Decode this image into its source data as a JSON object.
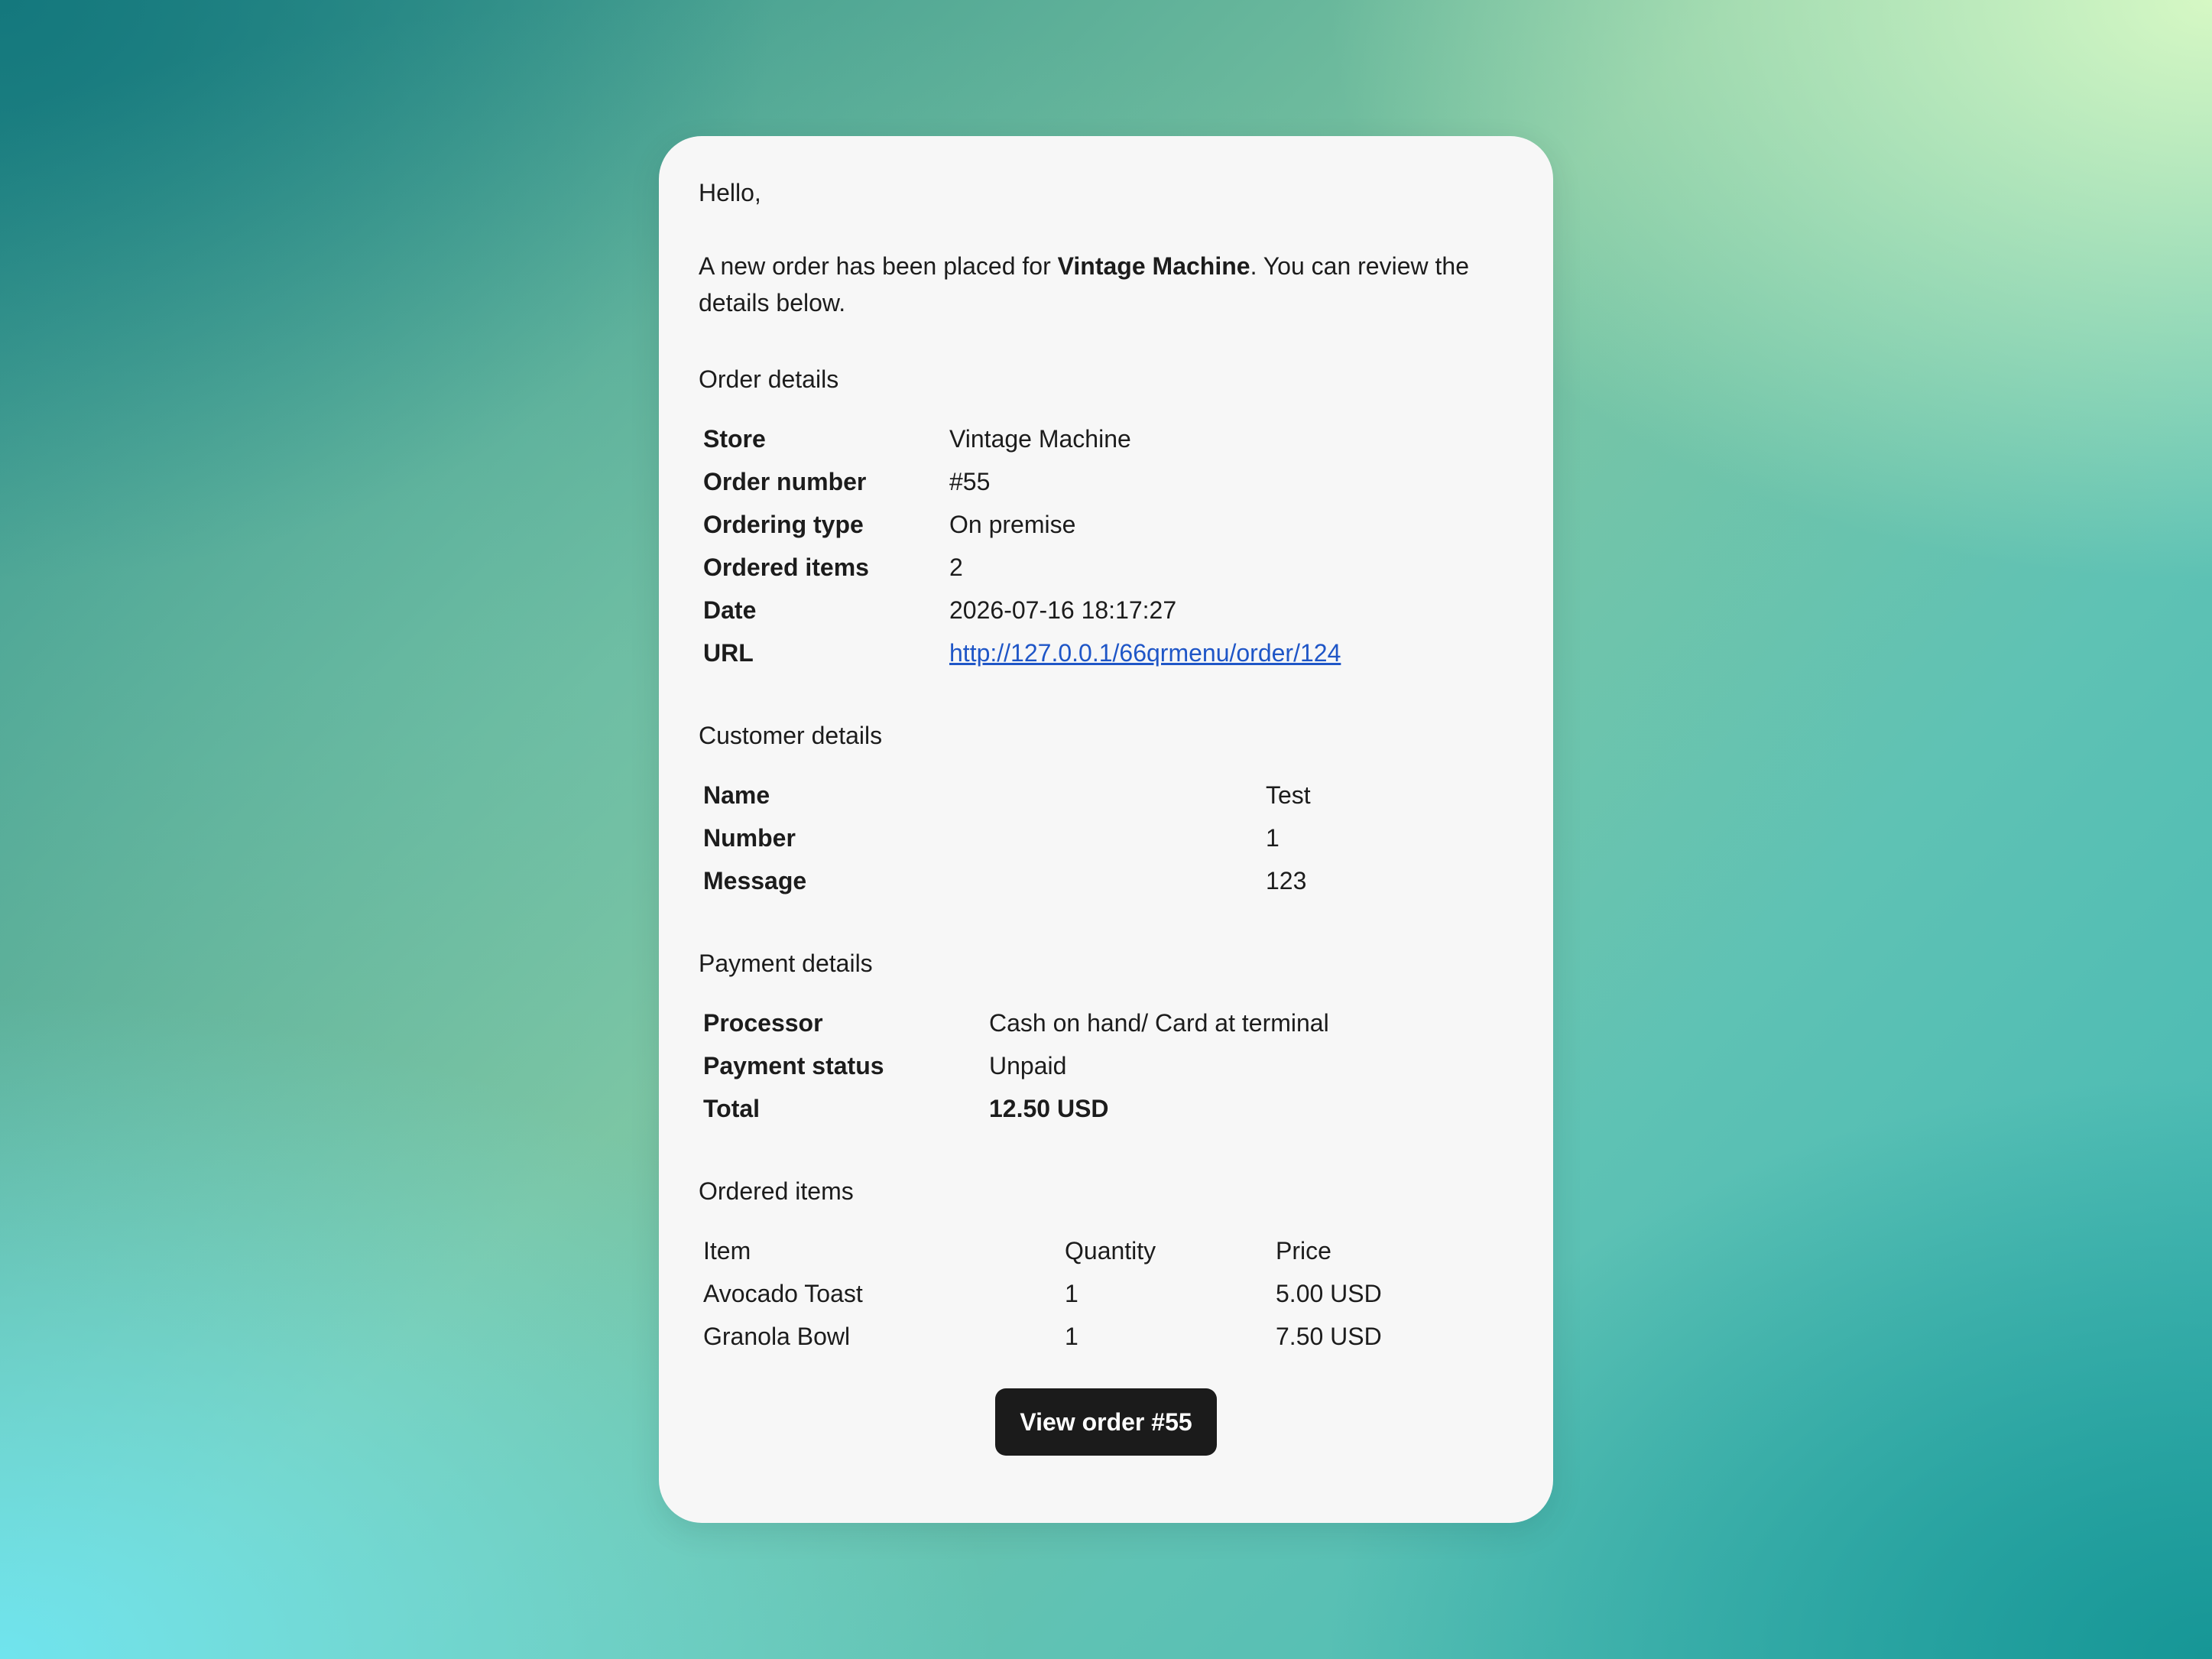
{
  "colors": {
    "card_background": "#f7f7f7",
    "button_background": "#1b1b1b",
    "button_text": "#ffffff",
    "link": "#1f56c7"
  },
  "email": {
    "greeting": "Hello,",
    "intro_prefix": "A new order has been placed for ",
    "intro_store": "Vintage Machine",
    "intro_suffix": ". You can review the details below."
  },
  "order_details": {
    "title": "Order details",
    "rows": [
      {
        "label": "Store",
        "value": "Vintage Machine"
      },
      {
        "label": "Order number",
        "value": "#55"
      },
      {
        "label": "Ordering type",
        "value": "On premise"
      },
      {
        "label": "Ordered items",
        "value": "2"
      },
      {
        "label": "Date",
        "value": "2026-07-16 18:17:27"
      },
      {
        "label": "URL",
        "value": "http://127.0.0.1/66qrmenu/order/124"
      }
    ]
  },
  "customer_details": {
    "title": "Customer details",
    "rows": [
      {
        "label": "Name",
        "value": "Test"
      },
      {
        "label": "Number",
        "value": "1"
      },
      {
        "label": "Message",
        "value": "123"
      }
    ]
  },
  "payment_details": {
    "title": "Payment details",
    "rows": [
      {
        "label": "Processor",
        "value": "Cash on hand/ Card at terminal"
      },
      {
        "label": "Payment status",
        "value": "Unpaid"
      },
      {
        "label": "Total",
        "value": "12.50 USD"
      }
    ]
  },
  "ordered_items": {
    "title": "Ordered items",
    "headers": [
      "Item",
      "Quantity",
      "Price"
    ],
    "rows": [
      {
        "item": "Avocado Toast",
        "quantity": "1",
        "price": "5.00 USD"
      },
      {
        "item": "Granola Bowl",
        "quantity": "1",
        "price": "7.50 USD"
      }
    ]
  },
  "cta": {
    "label": "View order #55"
  }
}
